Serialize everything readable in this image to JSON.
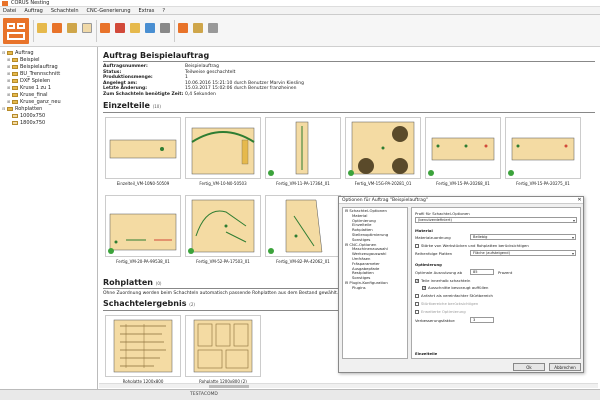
{
  "window": {
    "title": "CORUS Nesting"
  },
  "menu": [
    "Datei",
    "Auftrag",
    "Schachteln",
    "CNC-Generierung",
    "Extras",
    "?"
  ],
  "sidebar": {
    "items": [
      {
        "label": "Auftrag",
        "level": 0,
        "icon": "folder"
      },
      {
        "label": "Beispiel",
        "level": 1,
        "icon": "folder"
      },
      {
        "label": "Beispielauftrag",
        "level": 1,
        "icon": "folder"
      },
      {
        "label": "BU_Trennschnitt",
        "level": 1,
        "icon": "folder"
      },
      {
        "label": "DXF Spielen",
        "level": 1,
        "icon": "folder"
      },
      {
        "label": "Kruse 1 zu 1",
        "level": 1,
        "icon": "folder"
      },
      {
        "label": "Kruse_final",
        "level": 1,
        "icon": "folder"
      },
      {
        "label": "Kruse_ganz_neu",
        "level": 1,
        "icon": "folder"
      },
      {
        "label": "Rohplatten",
        "level": 0,
        "icon": "folder"
      },
      {
        "label": "1000x750",
        "level": 1,
        "icon": "sheet"
      },
      {
        "label": "1800x750",
        "level": 1,
        "icon": "sheet"
      }
    ]
  },
  "order": {
    "title": "Auftrag Beispielauftrag",
    "fields": [
      {
        "key": "Auftragsnummer:",
        "value": "Beispielauftrag"
      },
      {
        "key": "Status:",
        "value": "Teilweise geschachtelt"
      },
      {
        "key": "Produktionsmenge:",
        "value": "1"
      },
      {
        "key": "Angelegt am:",
        "value": "10.06.2016 15:21:10 durch Benutzer Marvin Kiesling"
      },
      {
        "key": "Letzte Änderung:",
        "value": "15.03.2017 15:02:06 durch Benutzer franzheinen"
      },
      {
        "key": "Zum Schachteln benötigte Zeit:",
        "value": "0,4 Sekunden"
      }
    ]
  },
  "parts": {
    "heading": "Einzelteile",
    "count": "(10)",
    "items": [
      {
        "label": "Einzelteil_VM-10N0-50509"
      },
      {
        "label": "Fertig_VM-10-N0-50503"
      },
      {
        "label": "Fertig_VM-11-PA-17364_01"
      },
      {
        "label": "Fertig_VM-15G-PA-20281_01"
      },
      {
        "label": "Fertig_VM-15-PA-20268_01"
      },
      {
        "label": "Fertig_VM-15-PA-20275_01"
      },
      {
        "label": "Fertig_VM-20-PA-99538_01"
      },
      {
        "label": "Fertig_VM-52-PA-17503_01"
      },
      {
        "label": "Fertig_VM-82-PA-42062_01"
      }
    ]
  },
  "rawplates": {
    "heading": "Rohplatten",
    "count": "(0)",
    "note": "Ohne Zuordnung werden beim Schachteln automatisch passende Rohplatten aus dem Bestand gewählt."
  },
  "result": {
    "heading": "Schachtelergebnis",
    "count": "(2)",
    "items": [
      {
        "label": "Rohplatte 1200x800"
      },
      {
        "label": "Rohplatte 1200x800 (2)"
      }
    ]
  },
  "dialog": {
    "title": "Optionen für Auftrag \"Beispielauftrag\"",
    "close": "✕",
    "tree": [
      {
        "label": "Schachtel-Optionen",
        "level": 0
      },
      {
        "label": "Material",
        "level": 1
      },
      {
        "label": "Optimierung",
        "level": 1
      },
      {
        "label": "Einzelteile",
        "level": 1
      },
      {
        "label": "Rohplatten",
        "level": 1
      },
      {
        "label": "Stellenoptimierung",
        "level": 1
      },
      {
        "label": "Sonstiges",
        "level": 1
      },
      {
        "label": "CNC-Optionen",
        "level": 0
      },
      {
        "label": "Maschinenauswahl",
        "level": 1
      },
      {
        "label": "Werkzeugauswahl",
        "level": 1
      },
      {
        "label": "Umfräsen",
        "level": 1
      },
      {
        "label": "Fräsparameter",
        "level": 1
      },
      {
        "label": "Ausgabepfade",
        "level": 1
      },
      {
        "label": "Restplatten",
        "level": 1
      },
      {
        "label": "Sonstiges",
        "level": 1
      },
      {
        "label": "Plugin-Konfiguration",
        "level": 0
      },
      {
        "label": "Plugins",
        "level": 1
      }
    ],
    "profile_label": "Profil für Schachtel-Optionen",
    "profile_value": "(benutzerdefiniert)",
    "material_section": "Material",
    "material_assign_label": "Materialzuordnung",
    "material_assign_value": "Beliebig",
    "cb_thickness": "Stärke von Werkstücken und Rohplatten berücksichtigen",
    "order_label": "Reihenfolge Platten",
    "order_value": "Fläche (aufsteigend)",
    "optim_section": "Optimierung",
    "optim_rate_label": "Optimale Ausnutzung ab",
    "optim_rate_value": "85",
    "optim_rate_unit": "Prozent",
    "cb_parts_rest": "Teile innerhalb schachteln",
    "cb_cutout": "Ausschnitte bevorzugt auffüllen",
    "cb_run": "Anfahrt als vereinfachter Stürtbereich",
    "cb_small": "Stürtbereiche berücksichtigen",
    "cb_ext": "Erweiterte Optimierung",
    "improve_label": "Verbesserungsfaktor:",
    "improve_value": "3",
    "parts_section": "Einzelteile",
    "ok": "Ok",
    "cancel": "Abbrechen"
  },
  "status": {
    "text": "TESTACOMD"
  }
}
